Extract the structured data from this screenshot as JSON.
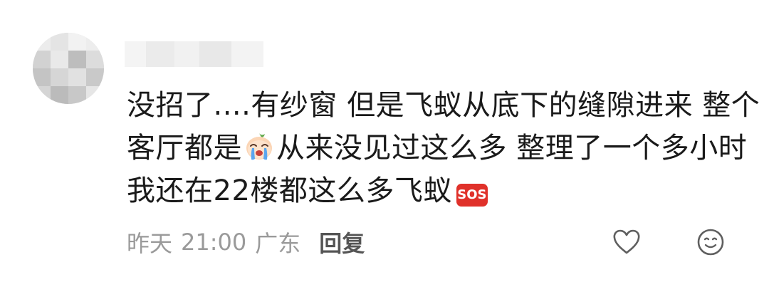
{
  "comment": {
    "text_lines": [
      {
        "before": "没招了....有纱窗 但是飞蚁从底下的缝隙进来 整个"
      },
      {
        "before": "客厅都是",
        "emoji": "crying-face-emoji",
        "after": "从来没见过这么多 整理了一个多小时"
      },
      {
        "before": "我还在22楼都这么多飞蚁",
        "emoji": "sos-emoji"
      }
    ],
    "sos_label": "SOS",
    "date": "昨天",
    "time": "21:00",
    "location": "广东",
    "reply_label": "回复",
    "like_icon": "heart-outline-icon",
    "react_icon": "smiley-face-icon"
  },
  "colors": {
    "text": "#1a1a1a",
    "meta": "#9a9a9a",
    "reply": "#555555",
    "sos": "#e0312a"
  }
}
